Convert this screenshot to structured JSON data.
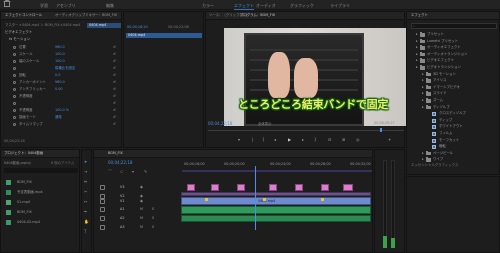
{
  "menubar": {
    "items": [
      "学習",
      "アセンブリ",
      "編集",
      "カラー",
      "エフェクト",
      "オーディオ",
      "グラフィック",
      "ライブラリ"
    ],
    "active_index": 4
  },
  "effect_controls": {
    "tabs": [
      "エフェクトコントロール",
      "オーディオクリップミキサー：BGM_FIX"
    ],
    "source_label": "マスター＊0404.mp4 ＞ BGM_FIX＊0404.mp4",
    "clip_label": "0404.mp4",
    "section_video": "ビデオエフェクト",
    "section_motion": "fx モーション",
    "rows": [
      {
        "label": "位置",
        "value": "960.0"
      },
      {
        "label": "スケール",
        "value": "100.0"
      },
      {
        "label": "幅のスケール",
        "value": "100.0"
      },
      {
        "label": "",
        "value": "縦横比を固定"
      },
      {
        "label": "回転",
        "value": "0.0"
      },
      {
        "label": "アンカーポイント",
        "value": "960.0"
      },
      {
        "label": "アンチフリッカー",
        "value": "0.00"
      },
      {
        "label": "不透明度",
        "value": ""
      },
      {
        "label": "",
        "value": ""
      },
      {
        "label": "不透明度",
        "value": "100.0 %"
      },
      {
        "label": "描画モード",
        "value": "通常"
      },
      {
        "label": "タイムリマップ",
        "value": ""
      }
    ],
    "footer_time": "00;04;22;18"
  },
  "program_monitor": {
    "tabs": [
      "ソース：（クリップなし）",
      "プログラム：BGM_FIX"
    ],
    "timecode": "00;04;22;18",
    "fit_label": "全体表示",
    "duration": "00;06;49;27",
    "subtitle": "ところどころ結束バンドで固定"
  },
  "source_strip": {
    "timecode_left": "00;04;18;20",
    "timecode_right": "00;04;22;08",
    "clip": "0404.mp4"
  },
  "effects_panel": {
    "title": "エフェクト",
    "items": [
      {
        "label": "プリセット",
        "type": "folder"
      },
      {
        "label": "Lumetri プリセット",
        "type": "folder"
      },
      {
        "label": "オーディオエフェクト",
        "type": "folder"
      },
      {
        "label": "オーディオトランジション",
        "type": "folder"
      },
      {
        "label": "ビデオエフェクト",
        "type": "folder"
      },
      {
        "label": "ビデオトランジション",
        "type": "folder"
      },
      {
        "label": "3D モーション",
        "type": "folder"
      },
      {
        "label": "アイリス",
        "type": "folder"
      },
      {
        "label": "イマーシブビデオ",
        "type": "folder"
      },
      {
        "label": "スライド",
        "type": "folder"
      },
      {
        "label": "ズーム",
        "type": "folder"
      },
      {
        "label": "ディゾルブ",
        "type": "folder"
      },
      {
        "label": "クロスディゾルブ",
        "type": "effect"
      },
      {
        "label": "ディップ",
        "type": "effect"
      },
      {
        "label": "ホワイトアウト",
        "type": "effect"
      },
      {
        "label": "フィルム",
        "type": "effect"
      },
      {
        "label": "モーフカット",
        "type": "effect"
      },
      {
        "label": "暗転",
        "type": "effect"
      },
      {
        "label": "ページピール",
        "type": "folder"
      },
      {
        "label": "ワイプ",
        "type": "folder"
      }
    ],
    "footer": "エッセンシャルグラフィックス"
  },
  "project_panel": {
    "title": "プロジェクト：0404動画",
    "path": "0404動画.prproj",
    "items_count": "6 個のアイテム",
    "items": [
      {
        "name": "BGM_FIX",
        "color": "#3f9f6a"
      },
      {
        "name": "予定表動画.mp4",
        "color": "#2f8f5a"
      },
      {
        "name": "01.mp4",
        "color": "#4aa86f"
      },
      {
        "name": "BGM_FIX",
        "color": "#3f9f6a"
      },
      {
        "name": "0404-02.mp4",
        "color": "#3a9a66"
      }
    ]
  },
  "timeline": {
    "tab": "BGM_FIX",
    "timecode": "00;04;22;18",
    "ruler": [
      "00;04;16;00",
      "00;04;20;00",
      "00;04;24;00",
      "00;04;28;00",
      "00;04;32;00"
    ],
    "tracks": [
      "V3",
      "V2",
      "V1",
      "A1",
      "A2",
      "A3"
    ],
    "v1_clip": "0404.mp4",
    "playhead_color": "#4b8fe8",
    "colors": {
      "pink": "#e07ad0",
      "blue": "#6f8bd0",
      "green": "#2f9a5a",
      "purple": "#b07ad8"
    }
  }
}
